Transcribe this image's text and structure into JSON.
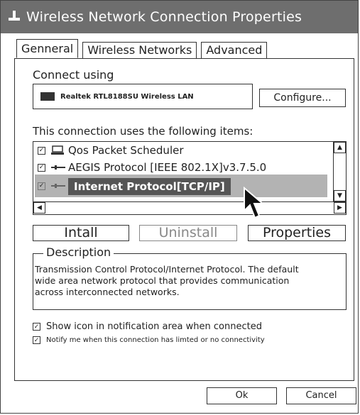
{
  "window": {
    "title": "Wireless Network Connection Properties",
    "icon": "network-icon"
  },
  "tabs": [
    {
      "label": "Genneral",
      "active": true
    },
    {
      "label": "Wireless Networks",
      "active": false
    },
    {
      "label": "Advanced",
      "active": false
    }
  ],
  "connect_using": {
    "label": "Connect using",
    "adapter": "Realtek RTL8188SU Wireless LAN",
    "configure_label": "Configure..."
  },
  "items_section": {
    "label": "This connection uses the following items:",
    "items": [
      {
        "label": "Qos Packet Scheduler",
        "checked": true,
        "icon": "scheduler-icon"
      },
      {
        "label": "AEGIS Protocol [IEEE 802.1X]v3.7.5.0",
        "checked": true,
        "icon": "protocol-icon"
      },
      {
        "label": "Internet Protocol[TCP/IP]",
        "checked": true,
        "icon": "protocol-icon",
        "selected": true
      }
    ]
  },
  "buttons": {
    "install": "Intall",
    "uninstall": "Uninstall",
    "properties": "Properties"
  },
  "description": {
    "legend": "Description",
    "line1": "Transmission Control Protocol/Internet Protocol. The default",
    "line2": "wide area network protocol that provides communication",
    "line3": "across interconnected networks."
  },
  "options": {
    "show_icon": {
      "label": "Show icon in notification area when connected",
      "checked": true
    },
    "notify": {
      "label": "Notify me when this connection has limted or no connectivity",
      "checked": true
    }
  },
  "footer": {
    "ok": "Ok",
    "cancel": "Cancel"
  }
}
